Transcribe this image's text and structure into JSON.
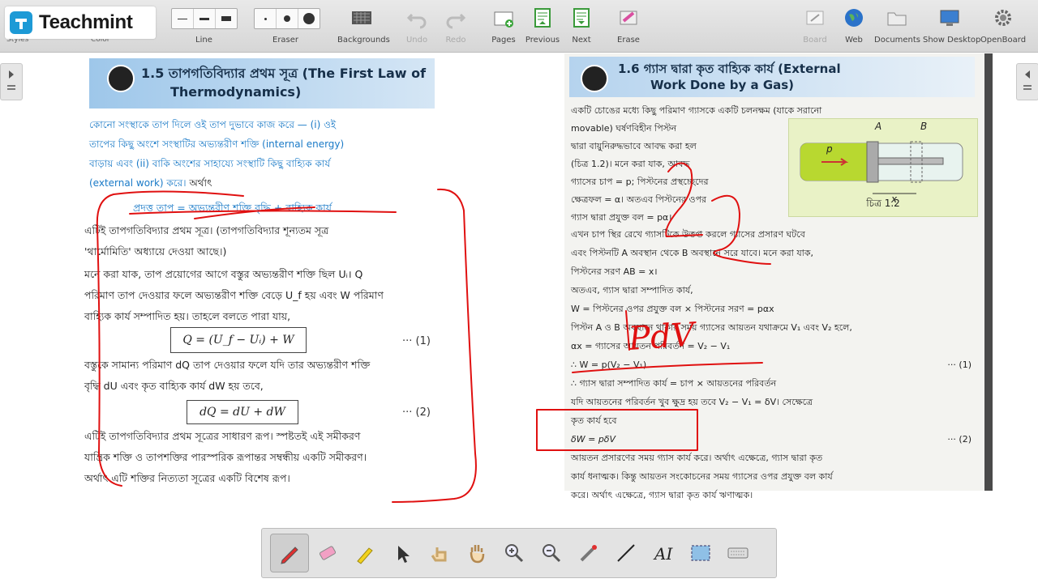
{
  "app": {
    "brand": "Teachmint",
    "under_logo_left": "Styles",
    "under_logo_right": "Color"
  },
  "toolbar": {
    "line_label": "Line",
    "eraser_label": "Eraser",
    "backgrounds_label": "Backgrounds",
    "undo_label": "Undo",
    "redo_label": "Redo",
    "pages_label": "Pages",
    "previous_label": "Previous",
    "next_label": "Next",
    "erase_label": "Erase",
    "board_label": "Board",
    "web_label": "Web",
    "documents_label": "Documents",
    "show_desktop_label": "Show Desktop",
    "openboard_label": "OpenBoard"
  },
  "left_page": {
    "section_title_1": "1.5 তাপগতিবিদ্যার প্রথম সূত্র (The First Law of",
    "section_title_2": "Thermodynamics)",
    "intro_1": "কোনো সংস্থাকে তাপ দিলে ওই তাপ দুভাবে কাজ করে — (i) ওই",
    "intro_2": "তাপের কিছু অংশে সংস্থাটির অভ্যন্তরীণ শক্তি (internal energy)",
    "intro_3": "বাড়ায় এবং (ii) বাকি অংশের সাহায্যে সংস্থাটি কিছু বাহ্যিক কার্য",
    "intro_4": "(external work) করে।",
    "intro_5": "অর্থাৎ",
    "key_eq": "প্রদত্ত তাপ = অভ্যন্তরীণ শক্তি বৃদ্ধি + বাহ্যিক কার্য",
    "p1_1": "এটিই তাপগতিবিদ্যার প্রথম সূত্র। (তাপগতিবিদ্যার শূন্যতম সূত্র",
    "p1_2": "'থার্মোমিতি' অধ্যায়ে দেওয়া আছে।)",
    "p2_1": "মনে করা যাক, তাপ প্রয়োগের আগে বস্তুর অভ্যন্তরীণ শক্তি ছিল Uᵢ। Q",
    "p2_2": "পরিমাণ তাপ দেওয়ার ফলে অভ্যন্তরীণ শক্তি বেড়ে U_f হয় এবং W পরিমাণ",
    "p2_3": "বাহ্যিক কার্য সম্পাদিত হয়। তাহলে বলতে পারা যায়,",
    "eq1": "Q = (U_f − Uᵢ) + W",
    "eq1_num": "··· (1)",
    "p3_1": "বস্তুকে সামান্য পরিমাণ dQ তাপ দেওয়ার ফলে যদি তার অভ্যন্তরীণ শক্তি",
    "p3_2": "বৃদ্ধি dU এবং কৃত বাহ্যিক কার্য dW হয় তবে,",
    "eq2": "dQ = dU + dW",
    "eq2_num": "··· (2)",
    "p4_1": "এটিই তাপগতিবিদ্যার প্রথম সূত্রের সাধারণ রূপ। স্পষ্টতই এই সমীকরণ",
    "p4_2": "যান্ত্রিক শক্তি ও তাপশক্তির পারস্পরিক রূপান্তর সম্বন্ধীয় একটি সমীকরণ।",
    "p4_3": "অর্থাৎ এটি শক্তির নিত্যতা সূত্রের একটি বিশেষ রূপ।"
  },
  "right_page": {
    "section_title_1": "1.6 গ্যাস দ্বারা কৃত বাহ্যিক কার্য (External",
    "section_title_2": "Work Done by a Gas)",
    "l1": "একটি চোঙের মধ্যে কিছু পরিমাণ গ্যাসকে একটি চলনক্ষম (যাকে সরানো",
    "l2": "movable) ঘর্ষণবিহীন পিস্টন",
    "l3": "দ্বারা বায়ুনিরুদ্ধভাবে আবদ্ধ করা হল",
    "l4": "(চিত্র 1.2)। মনে করা যাক, আবদ্ধ",
    "l5": "গ্যাসের চাপ = p; পিস্টনের প্রস্থচ্ছেদের",
    "l6": "ক্ষেত্রফল = α। অতএব পিস্টনের ওপর",
    "l7": "গ্যাস দ্বারা প্রযুক্ত বল = pα।",
    "l8": "এখন চাপ স্থির রেখে গ্যাসটিকে উত্তপ্ত করলে গ্যাসের প্রসারণ ঘটবে",
    "l9": "এবং পিস্টনটি A অবস্থান থেকে B অবস্থানে সরে যাবে। মনে করা যাক,",
    "l10": "পিস্টনের সরণ AB = x।",
    "l11": "অতএব, গ্যাস দ্বারা সম্পাদিত কার্য,",
    "l12": "W = পিস্টনের ওপর প্রযুক্ত বল × পিস্টনের সরণ = pαx",
    "l13": "পিস্টন A ও B অবস্থানে থাকার সময় গ্যাসের আয়তন যথাক্রমে V₁ এবং V₂ হলে,",
    "l14": "αx = গ্যাসের আয়তন পরিবর্তন = V₂ − V₁",
    "l15": "∴ W = p(V₂ − V₁)",
    "l15_num": "··· (1)",
    "l16": "∴ গ্যাস দ্বারা সম্পাদিত কার্য = চাপ × আয়তনের পরিবর্তন",
    "l17": "যদি আয়তনের পরিবর্তন খুব ক্ষুদ্র হয় তবে V₂ − V₁ = δV। সেক্ষেত্রে",
    "l18": "কৃত কার্য হবে",
    "l19": "δW = pδV",
    "l19_num": "··· (2)",
    "l20": "আয়তন প্রসারণের সময় গ্যাস কার্য করে। অর্থাৎ এক্ষেত্রে, গ্যাস দ্বারা কৃত",
    "l21": "কার্য ধনাত্মক। কিন্তু আয়তন সংকোচনের সময় গ্যাসের ওপর প্রযুক্ত বল কার্য",
    "l22": "করে। অর্থাৎ এক্ষেত্রে, গ্যাস দ্বারা কৃত কার্য ঋণাত্মক।",
    "fig_caption": "চিত্র 1.2",
    "fig_a": "A",
    "fig_b": "B",
    "fig_p": "p",
    "fig_x": "x"
  },
  "annotations": {
    "ink_color": "#e01010",
    "pdv_text": "PdV"
  },
  "colors": {
    "accent_blue": "#1a7ac7",
    "toolbar_bg": "#dcdcdc"
  }
}
